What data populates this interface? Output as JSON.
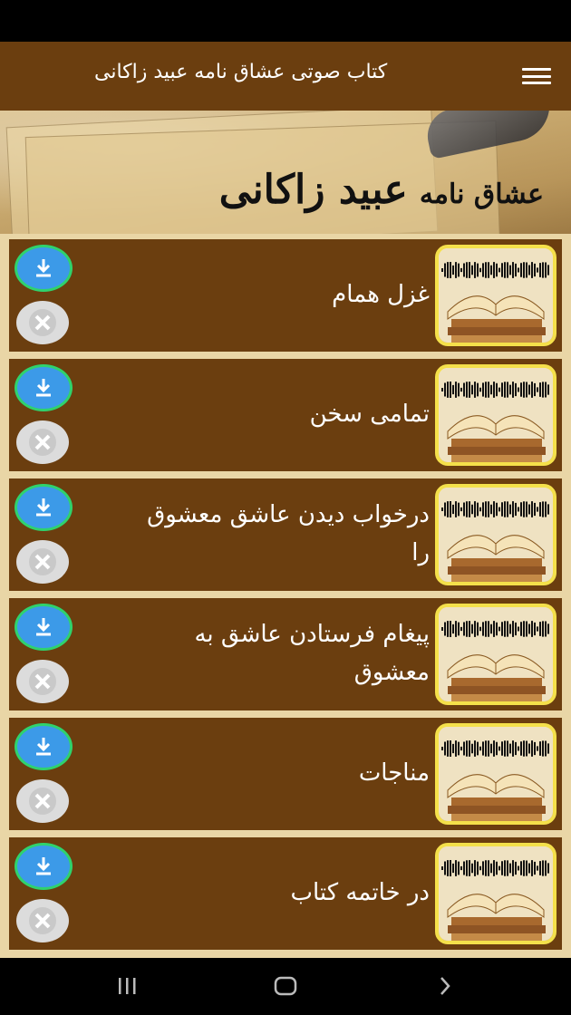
{
  "app_bar": {
    "title": "کتاب صوتی عشاق نامه عبید زاکانی",
    "menu_icon": "hamburger-menu-icon"
  },
  "banner": {
    "title_small": "عشاق نامه",
    "title_large": "عبید زاکانی"
  },
  "items": [
    {
      "label": "غزل همام"
    },
    {
      "label": "تمامی سخن"
    },
    {
      "label": "درخواب دیدن عاشق معشوق را"
    },
    {
      "label": "پیغام فرستادن عاشق به معشوق"
    },
    {
      "label": "مناجات"
    },
    {
      "label": "در خاتمه کتاب"
    }
  ],
  "row_icons": {
    "thumbnail": "book-waveform-thumbnail",
    "download": "download-icon",
    "delete": "close-icon"
  },
  "nav": {
    "recents_icon": "recents-icon",
    "home_icon": "home-icon",
    "back_icon": "back-icon"
  },
  "colors": {
    "app_bar": "#6b3e0f",
    "row_background": "#6b3e0f",
    "download_button": "#3c9ae8",
    "download_ring": "#2fd26d",
    "thumbnail_border": "#f4e04a",
    "delete_button": "#dcdcdc"
  }
}
